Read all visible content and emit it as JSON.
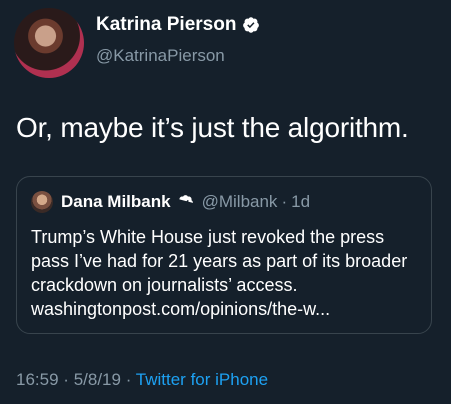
{
  "author": {
    "display_name": "Katrina Pierson",
    "handle": "@KatrinaPierson",
    "verified": true
  },
  "tweet": {
    "text": "Or, maybe it’s just the algorithm."
  },
  "quoted_tweet": {
    "display_name": "Dana Milbank",
    "handle": "@Milbank",
    "separator": "·",
    "time": "1d",
    "verified": true,
    "text": "Trump’s White House just revoked the press pass I’ve had for 21 years as part of its broader crackdown on journalists’ access. washingtonpost.com/opinions/the-w..."
  },
  "meta": {
    "time": "16:59",
    "date": "5/8/19",
    "separator": "·",
    "source": "Twitter for iPhone"
  },
  "colors": {
    "background": "#15202b",
    "text": "#ffffff",
    "secondary": "#8899a6",
    "link": "#1da1f2",
    "verified": "#ffffff",
    "border": "#38444d"
  }
}
